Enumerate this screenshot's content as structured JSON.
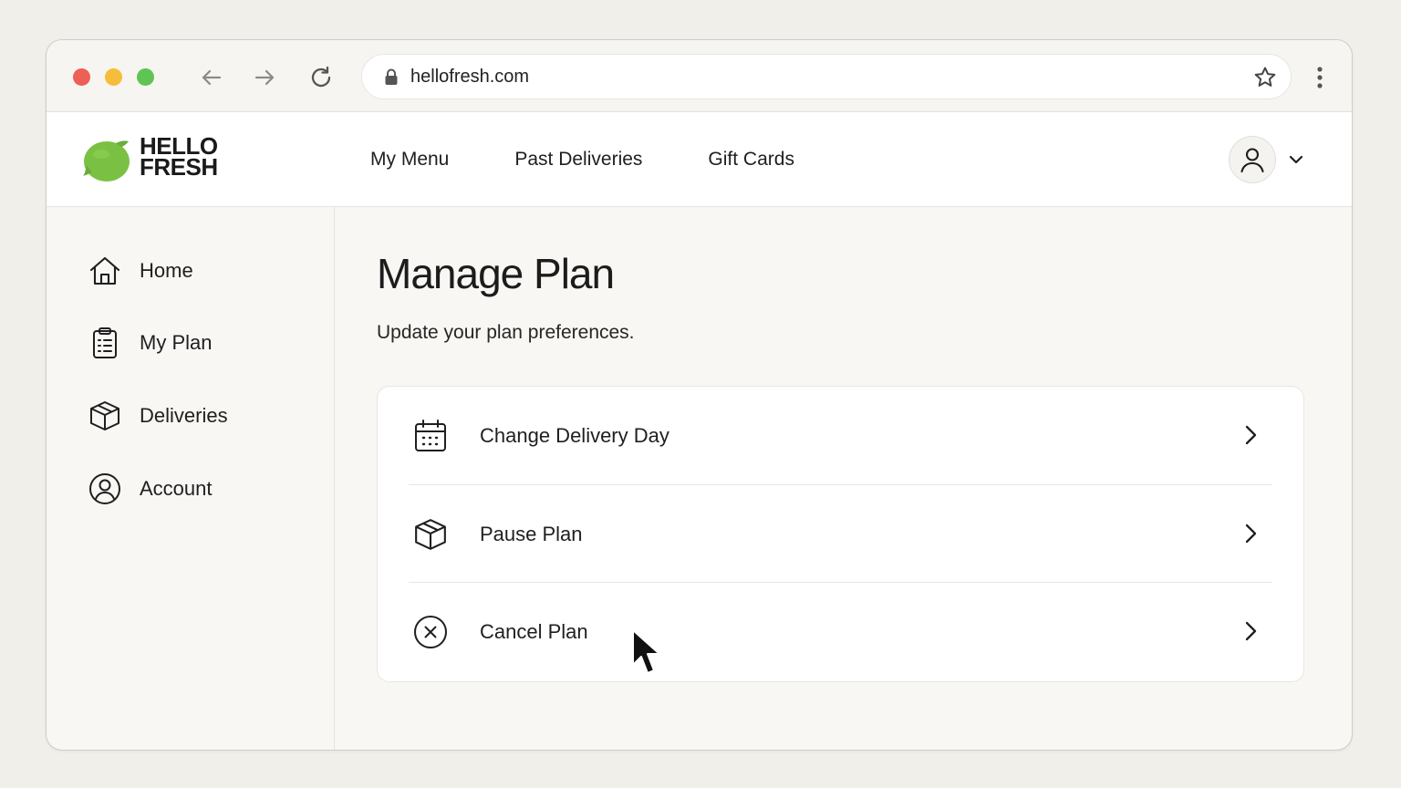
{
  "browser": {
    "url": "hellofresh.com"
  },
  "brand": {
    "logo_line1": "HELLO",
    "logo_line2": "FRESH",
    "accent_color": "#7ac143"
  },
  "topnav": {
    "items": [
      {
        "label": "My Menu"
      },
      {
        "label": "Past Deliveries"
      },
      {
        "label": "Gift Cards"
      }
    ]
  },
  "sidebar": {
    "items": [
      {
        "label": "Home",
        "icon": "home-icon"
      },
      {
        "label": "My Plan",
        "icon": "clipboard-icon"
      },
      {
        "label": "Deliveries",
        "icon": "box-icon"
      },
      {
        "label": "Account",
        "icon": "user-circle-icon"
      }
    ]
  },
  "main": {
    "title": "Manage Plan",
    "subtitle": "Update your plan preferences.",
    "options": [
      {
        "label": "Change Delivery Day",
        "icon": "calendar-icon"
      },
      {
        "label": "Pause Plan",
        "icon": "box-icon"
      },
      {
        "label": "Cancel Plan",
        "icon": "x-circle-icon"
      }
    ]
  }
}
